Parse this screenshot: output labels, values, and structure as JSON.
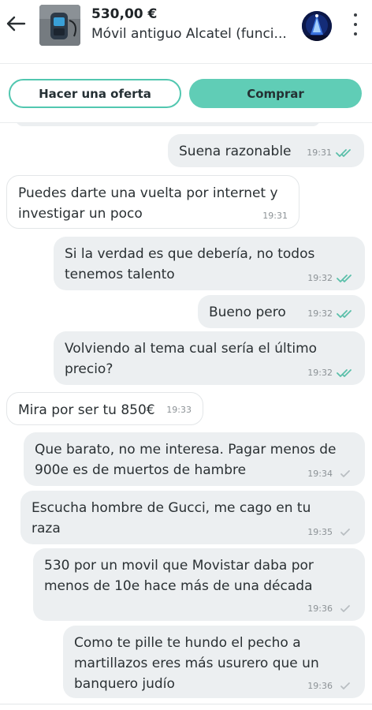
{
  "header": {
    "price": "530,00 €",
    "title": "Móvil antiguo Alcatel (funci...",
    "back_icon": "arrow-left-icon",
    "menu_icon": "kebab-menu-icon"
  },
  "actions": {
    "offer_label": "Hacer una oferta",
    "buy_label": "Comprar"
  },
  "colors": {
    "accent": "#60cdb6",
    "read_ticks": "#5bbfaa",
    "sent_ticks": "#b9bec2"
  },
  "messages": [
    {
      "dir": "out",
      "text": "Suena razonable",
      "time": "19:31",
      "status": "read"
    },
    {
      "dir": "in",
      "text": "Puedes darte una vuelta por internet y investigar un poco",
      "time": "19:31"
    },
    {
      "dir": "out",
      "text": "Si la verdad es que debería, no todos tenemos talento",
      "time": "19:32",
      "status": "read"
    },
    {
      "dir": "out",
      "text": "Bueno pero",
      "time": "19:32",
      "status": "read"
    },
    {
      "dir": "out",
      "text": "Volviendo al tema cual sería el último precio?",
      "time": "19:32",
      "status": "read"
    },
    {
      "dir": "in",
      "text": "Mira por ser tu 850€",
      "time": "19:33"
    },
    {
      "dir": "out",
      "text": "Que barato, no me interesa. Pagar menos de 900e es de muertos de hambre",
      "time": "19:34",
      "status": "sent"
    },
    {
      "dir": "out",
      "text": "Escucha hombre de Gucci, me cago en tu raza",
      "time": "19:35",
      "status": "sent"
    },
    {
      "dir": "out",
      "text": "530 por un movil que Movistar daba por menos de 10e hace más de una década",
      "time": "19:36",
      "status": "sent"
    },
    {
      "dir": "out",
      "text": "Como te pille te hundo el pecho a martillazos eres más usurero que un banquero judío",
      "time": "19:36",
      "status": "sent"
    }
  ]
}
